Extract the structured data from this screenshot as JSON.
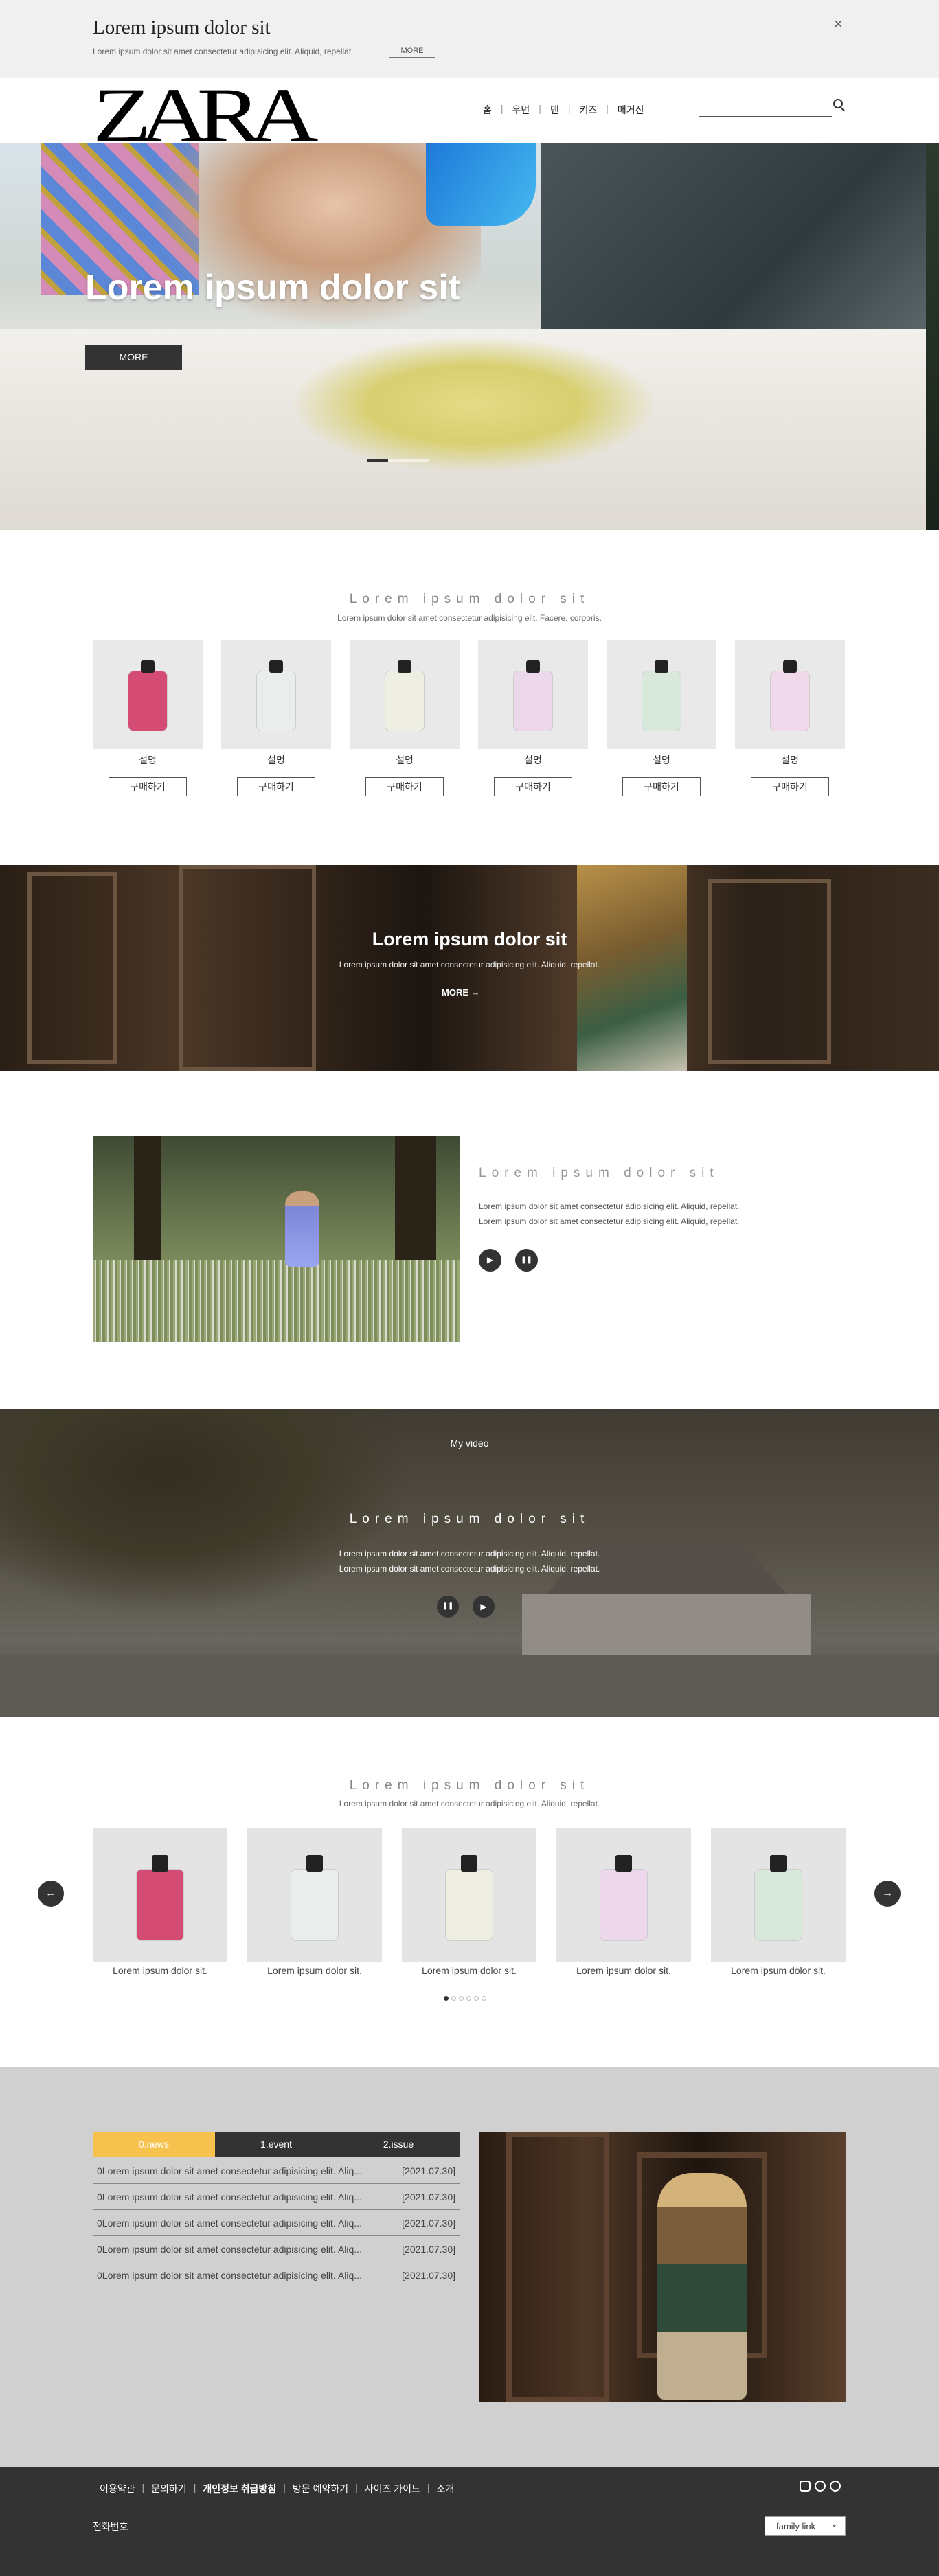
{
  "top_banner": {
    "title": "Lorem ipsum dolor sit",
    "subtitle": "Lorem ipsum dolor sit amet consectetur adipisicing elit. Aliquid, repellat.",
    "more": "MORE",
    "close": "×"
  },
  "header": {
    "logo": "ZARA",
    "nav": [
      "홈",
      "우먼",
      "맨",
      "키즈",
      "매거진"
    ],
    "search_placeholder": ""
  },
  "hero": {
    "title": "Lorem ipsum dolor sit",
    "button": "MORE",
    "slides": 3,
    "active_slide": 1
  },
  "products": {
    "heading": "Lorem ipsum dolor sit",
    "sub": "Lorem ipsum dolor sit amet consectetur adipisicing elit. Facere, corporis.",
    "items": [
      {
        "label": "설명",
        "buy": "구매하기",
        "color": "#d44c74"
      },
      {
        "label": "설명",
        "buy": "구매하기",
        "color": "#e9edec"
      },
      {
        "label": "설명",
        "buy": "구매하기",
        "color": "#efeee3"
      },
      {
        "label": "설명",
        "buy": "구매하기",
        "color": "#ecd8ea"
      },
      {
        "label": "설명",
        "buy": "구매하기",
        "color": "#d8e8da"
      },
      {
        "label": "설명",
        "buy": "구매하기",
        "color": "#f1d9ec"
      }
    ]
  },
  "banner2": {
    "title": "Lorem ipsum dolor sit",
    "text": "Lorem ipsum dolor sit amet consectetur adipisicing elit. Aliquid, repellat.",
    "more": "MORE →"
  },
  "video1": {
    "heading": "Lorem ipsum dolor sit",
    "lines": [
      "Lorem ipsum dolor sit amet consectetur adipisicing elit. Aliquid, repellat.",
      "Lorem ipsum dolor sit amet consectetur adipisicing elit. Aliquid, repellat."
    ],
    "play": "▶",
    "pause": "❚❚"
  },
  "video2": {
    "tag": "My video",
    "heading": "Lorem ipsum dolor sit",
    "lines": [
      "Lorem ipsum dolor sit amet consectetur adipisicing elit. Aliquid, repellat.",
      "Lorem ipsum dolor sit amet consectetur adipisicing elit. Aliquid, repellat."
    ],
    "pause": "❚❚",
    "play": "▶"
  },
  "slider": {
    "heading": "Lorem ipsum dolor sit",
    "sub": "Lorem ipsum dolor sit amet consectetur adipisicing elit. Aliquid, repellat.",
    "items": [
      {
        "caption": "Lorem ipsum dolor sit.",
        "color": "#d44c74"
      },
      {
        "caption": "Lorem ipsum dolor sit.",
        "color": "#e9edec"
      },
      {
        "caption": "Lorem ipsum dolor sit.",
        "color": "#efeee3"
      },
      {
        "caption": "Lorem ipsum dolor sit.",
        "color": "#ecd8ea"
      },
      {
        "caption": "Lorem ipsum dolor sit.",
        "color": "#d8e8da"
      }
    ],
    "prev": "←",
    "next": "→",
    "pages": 6,
    "active_page": 1
  },
  "news": {
    "tabs": [
      "0.news",
      "1.event",
      "2.issue"
    ],
    "active_tab": 0,
    "rows": [
      {
        "text": "0Lorem ipsum dolor sit amet consectetur adipisicing elit. Aliq...",
        "date": "[2021.07.30]"
      },
      {
        "text": "0Lorem ipsum dolor sit amet consectetur adipisicing elit. Aliq...",
        "date": "[2021.07.30]"
      },
      {
        "text": "0Lorem ipsum dolor sit amet consectetur adipisicing elit. Aliq...",
        "date": "[2021.07.30]"
      },
      {
        "text": "0Lorem ipsum dolor sit amet consectetur adipisicing elit. Aliq...",
        "date": "[2021.07.30]"
      },
      {
        "text": "0Lorem ipsum dolor sit amet consectetur adipisicing elit. Aliq...",
        "date": "[2021.07.30]"
      }
    ]
  },
  "footer": {
    "links": [
      "이용약관",
      "문의하기",
      "개인정보 취급방침",
      "방문 예약하기",
      "사이즈 가이드",
      "소개"
    ],
    "phone_label": "전화번호",
    "family_link": "family link",
    "icons": [
      "instagram-icon",
      "chat-icon",
      "github-icon"
    ]
  }
}
